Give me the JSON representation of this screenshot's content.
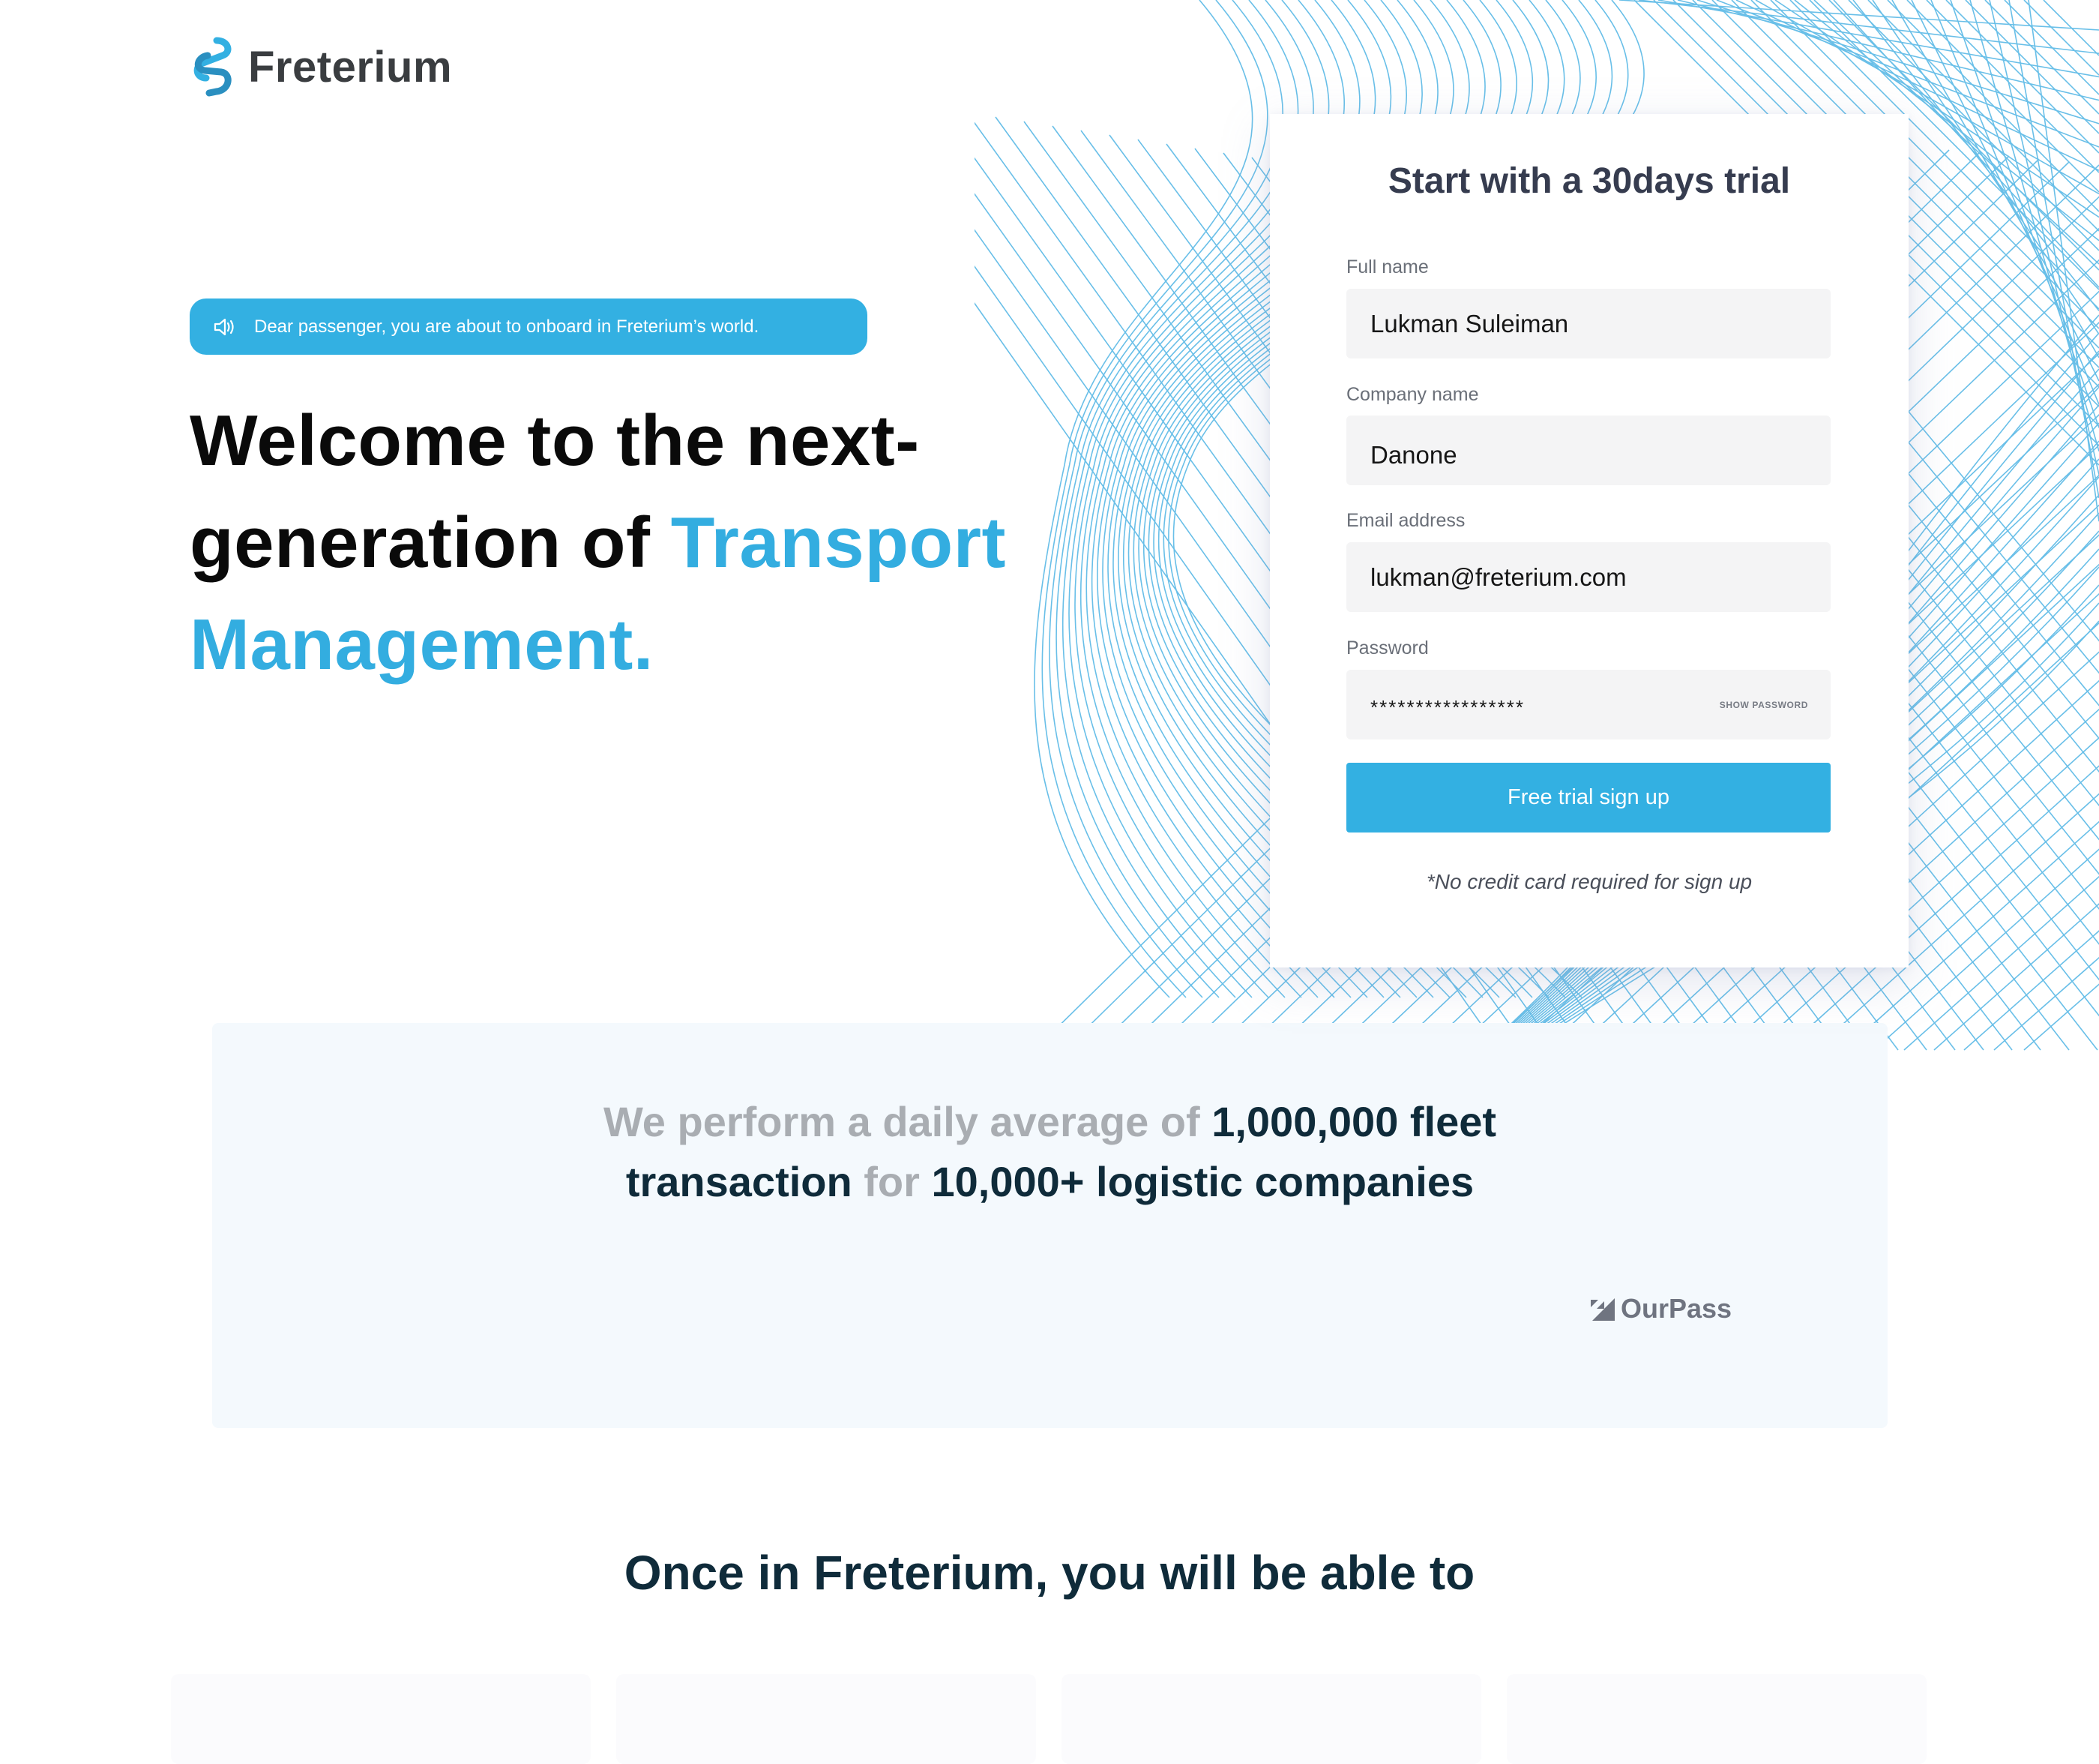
{
  "brand": {
    "name": "Freterium",
    "accent_color": "#33b0e2",
    "dark_color": "#0f2b3a"
  },
  "announcement": {
    "icon": "speaker-icon",
    "text": "Dear passenger, you are about to onboard in Freterium’s world."
  },
  "hero": {
    "line1": "Welcome to the next-",
    "line2_plain": "generation of ",
    "line2_accent": "Transport",
    "line3_accent": "Management."
  },
  "signup": {
    "title": "Start with a 30days trial",
    "full_name_label": "Full name",
    "full_name_value": "Lukman Suleiman",
    "company_label": "Company name",
    "company_value": "Danone",
    "email_label": "Email address",
    "email_value": "lukman@freterium.com",
    "password_label": "Password",
    "password_value": "*****************",
    "show_password_label": "SHOW PASSWORD",
    "button_label": "Free trial sign up",
    "note": "*No credit card required for sign up"
  },
  "stats": {
    "muted1": "We perform a daily average of ",
    "bold1": "1,000,000 fleet",
    "bold2": "transaction",
    "muted2": " for ",
    "bold3": "10,000+ logistic companies",
    "partner_logo": "OurPass"
  },
  "features": {
    "heading": "Once in Freterium, you will be able to"
  }
}
